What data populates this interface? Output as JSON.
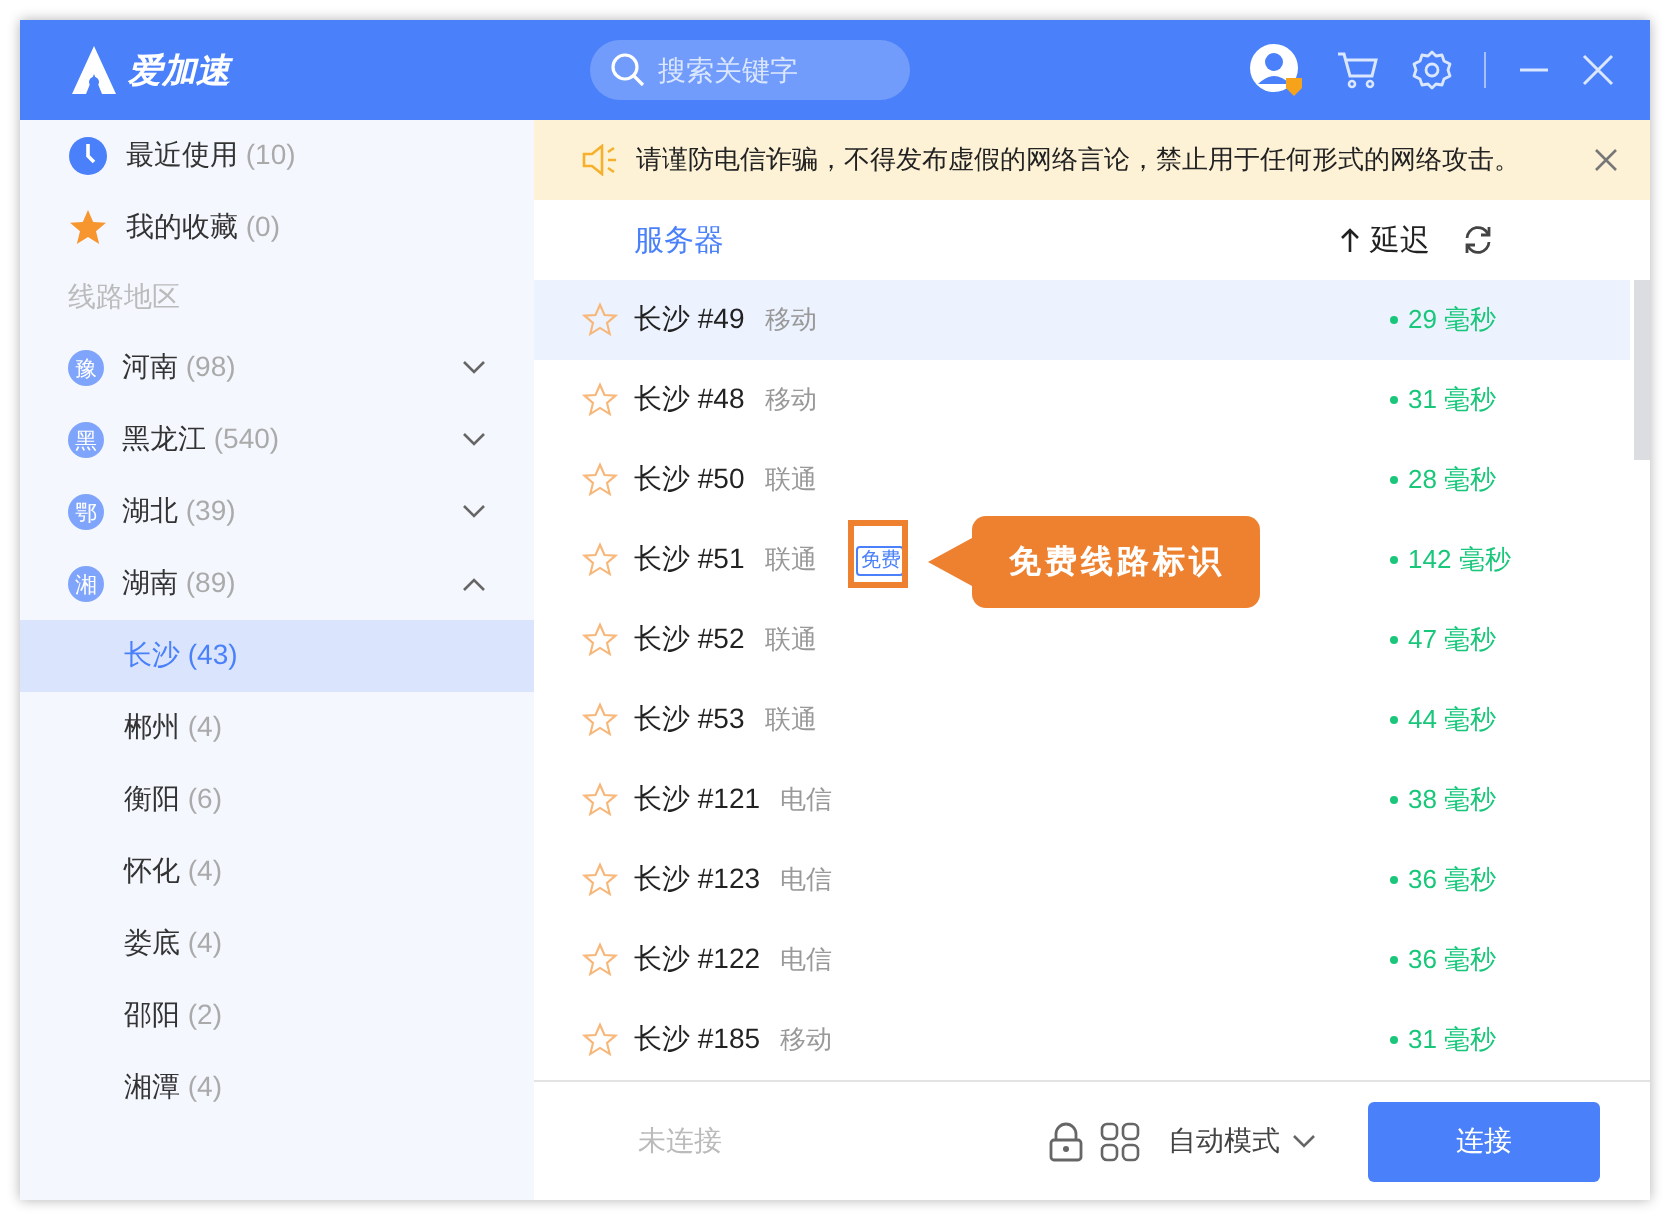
{
  "app": {
    "name": "爱加速"
  },
  "search": {
    "placeholder": "搜索关键字"
  },
  "sidebar": {
    "shortcuts": [
      {
        "kind": "recent",
        "label": "最近使用",
        "count": "(10)"
      },
      {
        "kind": "favorites",
        "label": "我的收藏",
        "count": "(0)"
      }
    ],
    "section_title": "线路地区",
    "regions": [
      {
        "badge": "豫",
        "label": "河南",
        "count": "(98)",
        "expanded": false
      },
      {
        "badge": "黑",
        "label": "黑龙江",
        "count": "(540)",
        "expanded": false
      },
      {
        "badge": "鄂",
        "label": "湖北",
        "count": "(39)",
        "expanded": false
      },
      {
        "badge": "湘",
        "label": "湖南",
        "count": "(89)",
        "expanded": true,
        "children": [
          {
            "label": "长沙",
            "count": "(43)",
            "selected": true
          },
          {
            "label": "郴州",
            "count": "(4)",
            "selected": false
          },
          {
            "label": "衡阳",
            "count": "(6)",
            "selected": false
          },
          {
            "label": "怀化",
            "count": "(4)",
            "selected": false
          },
          {
            "label": "娄底",
            "count": "(4)",
            "selected": false
          },
          {
            "label": "邵阳",
            "count": "(2)",
            "selected": false
          },
          {
            "label": "湘潭",
            "count": "(4)",
            "selected": false
          }
        ]
      }
    ]
  },
  "notice": {
    "text": "请谨防电信诈骗，不得发布虚假的网络言论，禁止用于任何形式的网络攻击。"
  },
  "table": {
    "columns": [
      "服务器",
      "延迟"
    ],
    "rows": [
      {
        "name": "长沙 #49",
        "isp": "移动",
        "latency": "29 毫秒",
        "favorite": false,
        "selected": true
      },
      {
        "name": "长沙 #48",
        "isp": "移动",
        "latency": "31 毫秒",
        "favorite": false,
        "selected": false
      },
      {
        "name": "长沙 #50",
        "isp": "联通",
        "latency": "28 毫秒",
        "favorite": false,
        "selected": false
      },
      {
        "name": "长沙 #51",
        "isp": "联通",
        "tag": "免费",
        "annotation": "免费线路标识",
        "latency": "142 毫秒",
        "favorite": false,
        "selected": false
      },
      {
        "name": "长沙 #52",
        "isp": "联通",
        "latency": "47 毫秒",
        "favorite": false,
        "selected": false
      },
      {
        "name": "长沙 #53",
        "isp": "联通",
        "latency": "44 毫秒",
        "favorite": false,
        "selected": false
      },
      {
        "name": "长沙 #121",
        "isp": "电信",
        "latency": "38 毫秒",
        "favorite": false,
        "selected": false
      },
      {
        "name": "长沙 #123",
        "isp": "电信",
        "latency": "36 毫秒",
        "favorite": false,
        "selected": false
      },
      {
        "name": "长沙 #122",
        "isp": "电信",
        "latency": "36 毫秒",
        "favorite": false,
        "selected": false
      },
      {
        "name": "长沙 #185",
        "isp": "移动",
        "latency": "31 毫秒",
        "favorite": false,
        "selected": false
      }
    ]
  },
  "footer": {
    "status": "未连接",
    "mode": "自动模式",
    "connect_button": "连接"
  }
}
